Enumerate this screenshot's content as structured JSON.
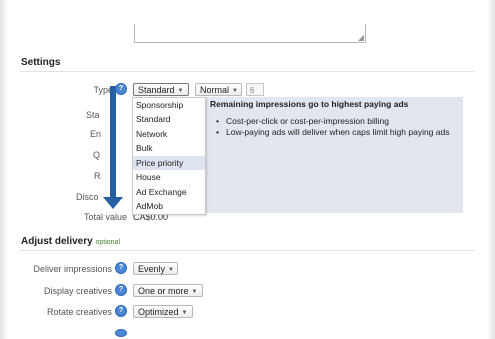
{
  "settings": {
    "title": "Settings",
    "type_label": "Type",
    "type_value": "Standard",
    "priority_value": "Normal",
    "priority_number": "6",
    "partial_labels": [
      "Sta",
      "En",
      "Q",
      "R",
      "Disco"
    ],
    "total_value_label": "Total value",
    "total_value": "CA$0.00"
  },
  "type_menu": {
    "items": [
      "Sponsorship",
      "Standard",
      "Network",
      "Bulk",
      "Price priority",
      "House",
      "Ad Exchange",
      "AdMob"
    ],
    "highlighted": "Price priority"
  },
  "info_panel": {
    "title": "Remaining impressions go to highest paying ads",
    "bullets": [
      "Cost-per-click or cost-per-impression billing",
      "Low-paying ads will deliver when caps limit high paying ads"
    ],
    "background": "#e2e6ef"
  },
  "adjust_delivery": {
    "title": "Adjust delivery",
    "optional": "optional",
    "rows": [
      {
        "label": "Deliver impressions",
        "value": "Evenly"
      },
      {
        "label": "Display creatives",
        "value": "One or more"
      },
      {
        "label": "Rotate creatives",
        "value": "Optimized"
      }
    ]
  },
  "help_glyph": "?",
  "annotation_arrow_color": "#2660a4"
}
